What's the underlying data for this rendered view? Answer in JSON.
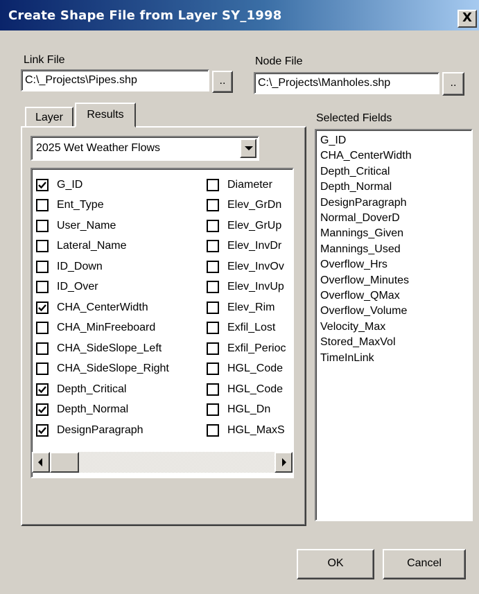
{
  "window": {
    "title": "Create Shape File from Layer SY_1998",
    "close_label": "X"
  },
  "link_file": {
    "label": "Link File",
    "value": "C:\\_Projects\\Pipes.shp",
    "browse_label": ".."
  },
  "node_file": {
    "label": "Node File",
    "value": "C:\\_Projects\\Manholes.shp",
    "browse_label": ".."
  },
  "tabs": [
    {
      "label": "Layer",
      "active": false
    },
    {
      "label": "Results",
      "active": true
    }
  ],
  "results": {
    "dropdown_value": "2025 Wet Weather Flows",
    "fields_col1": [
      {
        "label": "G_ID",
        "checked": true
      },
      {
        "label": "Ent_Type",
        "checked": false
      },
      {
        "label": "User_Name",
        "checked": false
      },
      {
        "label": "Lateral_Name",
        "checked": false
      },
      {
        "label": "ID_Down",
        "checked": false
      },
      {
        "label": "ID_Over",
        "checked": false
      },
      {
        "label": "CHA_CenterWidth",
        "checked": true
      },
      {
        "label": "CHA_MinFreeboard",
        "checked": false
      },
      {
        "label": "CHA_SideSlope_Left",
        "checked": false
      },
      {
        "label": "CHA_SideSlope_Right",
        "checked": false
      },
      {
        "label": "Depth_Critical",
        "checked": true
      },
      {
        "label": "Depth_Normal",
        "checked": true
      },
      {
        "label": "DesignParagraph",
        "checked": true
      }
    ],
    "fields_col2": [
      {
        "label": "Diameter",
        "checked": false
      },
      {
        "label": "Elev_GrDn",
        "checked": false
      },
      {
        "label": "Elev_GrUp",
        "checked": false
      },
      {
        "label": "Elev_InvDr",
        "checked": false
      },
      {
        "label": "Elev_InvOv",
        "checked": false
      },
      {
        "label": "Elev_InvUp",
        "checked": false
      },
      {
        "label": "Elev_Rim",
        "checked": false
      },
      {
        "label": "Exfil_Lost",
        "checked": false
      },
      {
        "label": "Exfil_Perioc",
        "checked": false
      },
      {
        "label": "HGL_Code",
        "checked": false
      },
      {
        "label": "HGL_Code",
        "checked": false
      },
      {
        "label": "HGL_Dn",
        "checked": false
      },
      {
        "label": "HGL_MaxS",
        "checked": false
      }
    ]
  },
  "selected_fields": {
    "label": "Selected Fields",
    "items": [
      "G_ID",
      "CHA_CenterWidth",
      "Depth_Critical",
      "Depth_Normal",
      "DesignParagraph",
      "Normal_DoverD",
      "Mannings_Given",
      "Mannings_Used",
      "Overflow_Hrs",
      "Overflow_Minutes",
      "Overflow_QMax",
      "Overflow_Volume",
      "Velocity_Max",
      "Stored_MaxVol",
      "TimeInLink"
    ]
  },
  "buttons": {
    "ok": "OK",
    "cancel": "Cancel"
  }
}
